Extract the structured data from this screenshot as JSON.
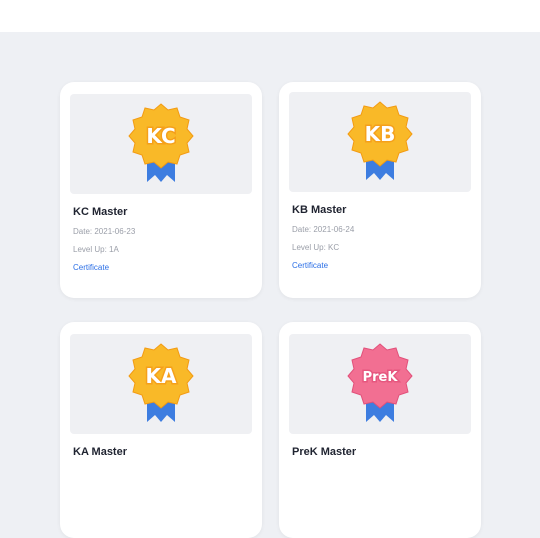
{
  "cards": [
    {
      "badge_text": "KC",
      "badge_color": "#f9b928",
      "badge_stroke": "#f39b12",
      "text_stroke": "#f5a01a",
      "title": "KC Master",
      "date": "Date: 2021-06-23",
      "level": "Level Up: 1A",
      "link_label": "Certificate"
    },
    {
      "badge_text": "KB",
      "badge_color": "#f9b928",
      "badge_stroke": "#f39b12",
      "text_stroke": "#f5a01a",
      "title": "KB Master",
      "date": "Date: 2021-06-24",
      "level": "Level Up: KC",
      "link_label": "Certificate"
    },
    {
      "badge_text": "KA",
      "badge_color": "#f9b928",
      "badge_stroke": "#f39b12",
      "text_stroke": "#f5a01a",
      "title": "KA Master",
      "date": "",
      "level": "",
      "link_label": ""
    },
    {
      "badge_text": "PreK",
      "badge_color": "#f26f92",
      "badge_stroke": "#e2507a",
      "text_stroke": "#e6577f",
      "title": "PreK Master",
      "date": "",
      "level": "",
      "link_label": ""
    }
  ],
  "ribbon_color": "#3d7de0"
}
